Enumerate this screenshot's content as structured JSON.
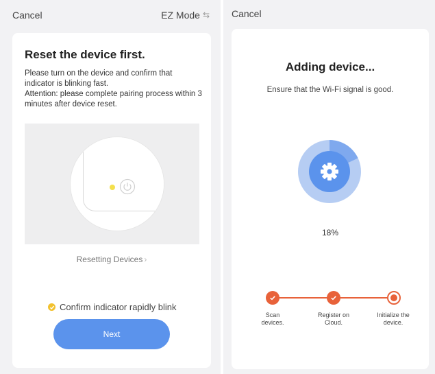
{
  "left": {
    "cancel_label": "Cancel",
    "mode_label": "EZ Mode",
    "mode_icon": "swap-arrows-icon",
    "title": "Reset the device first.",
    "description_line1": "Please turn on the device and confirm that indicator is blinking fast.",
    "description_line2": "Attention: please complete pairing process within 3 minutes after device reset.",
    "resetting_link": "Resetting Devices",
    "confirm_label": "Confirm indicator rapidly blink",
    "next_label": "Next",
    "colors": {
      "accent": "#5b93ec",
      "check": "#f2c12e",
      "led": "#f4e04d"
    }
  },
  "right": {
    "cancel_label": "Cancel",
    "title": "Adding device...",
    "subtitle": "Ensure that the Wi-Fi signal is good.",
    "progress": 18,
    "progress_label": "18%",
    "center_icon": "gear-icon",
    "steps": [
      {
        "label_line1": "Scan",
        "label_line2": "devices.",
        "state": "done"
      },
      {
        "label_line1": "Register on",
        "label_line2": "Cloud.",
        "state": "done"
      },
      {
        "label_line1": "Initialize the",
        "label_line2": "device.",
        "state": "in-progress"
      }
    ],
    "colors": {
      "ring": "#5b93ec",
      "ring_track": "#b6cdf3",
      "steps": "#e8623a"
    }
  }
}
